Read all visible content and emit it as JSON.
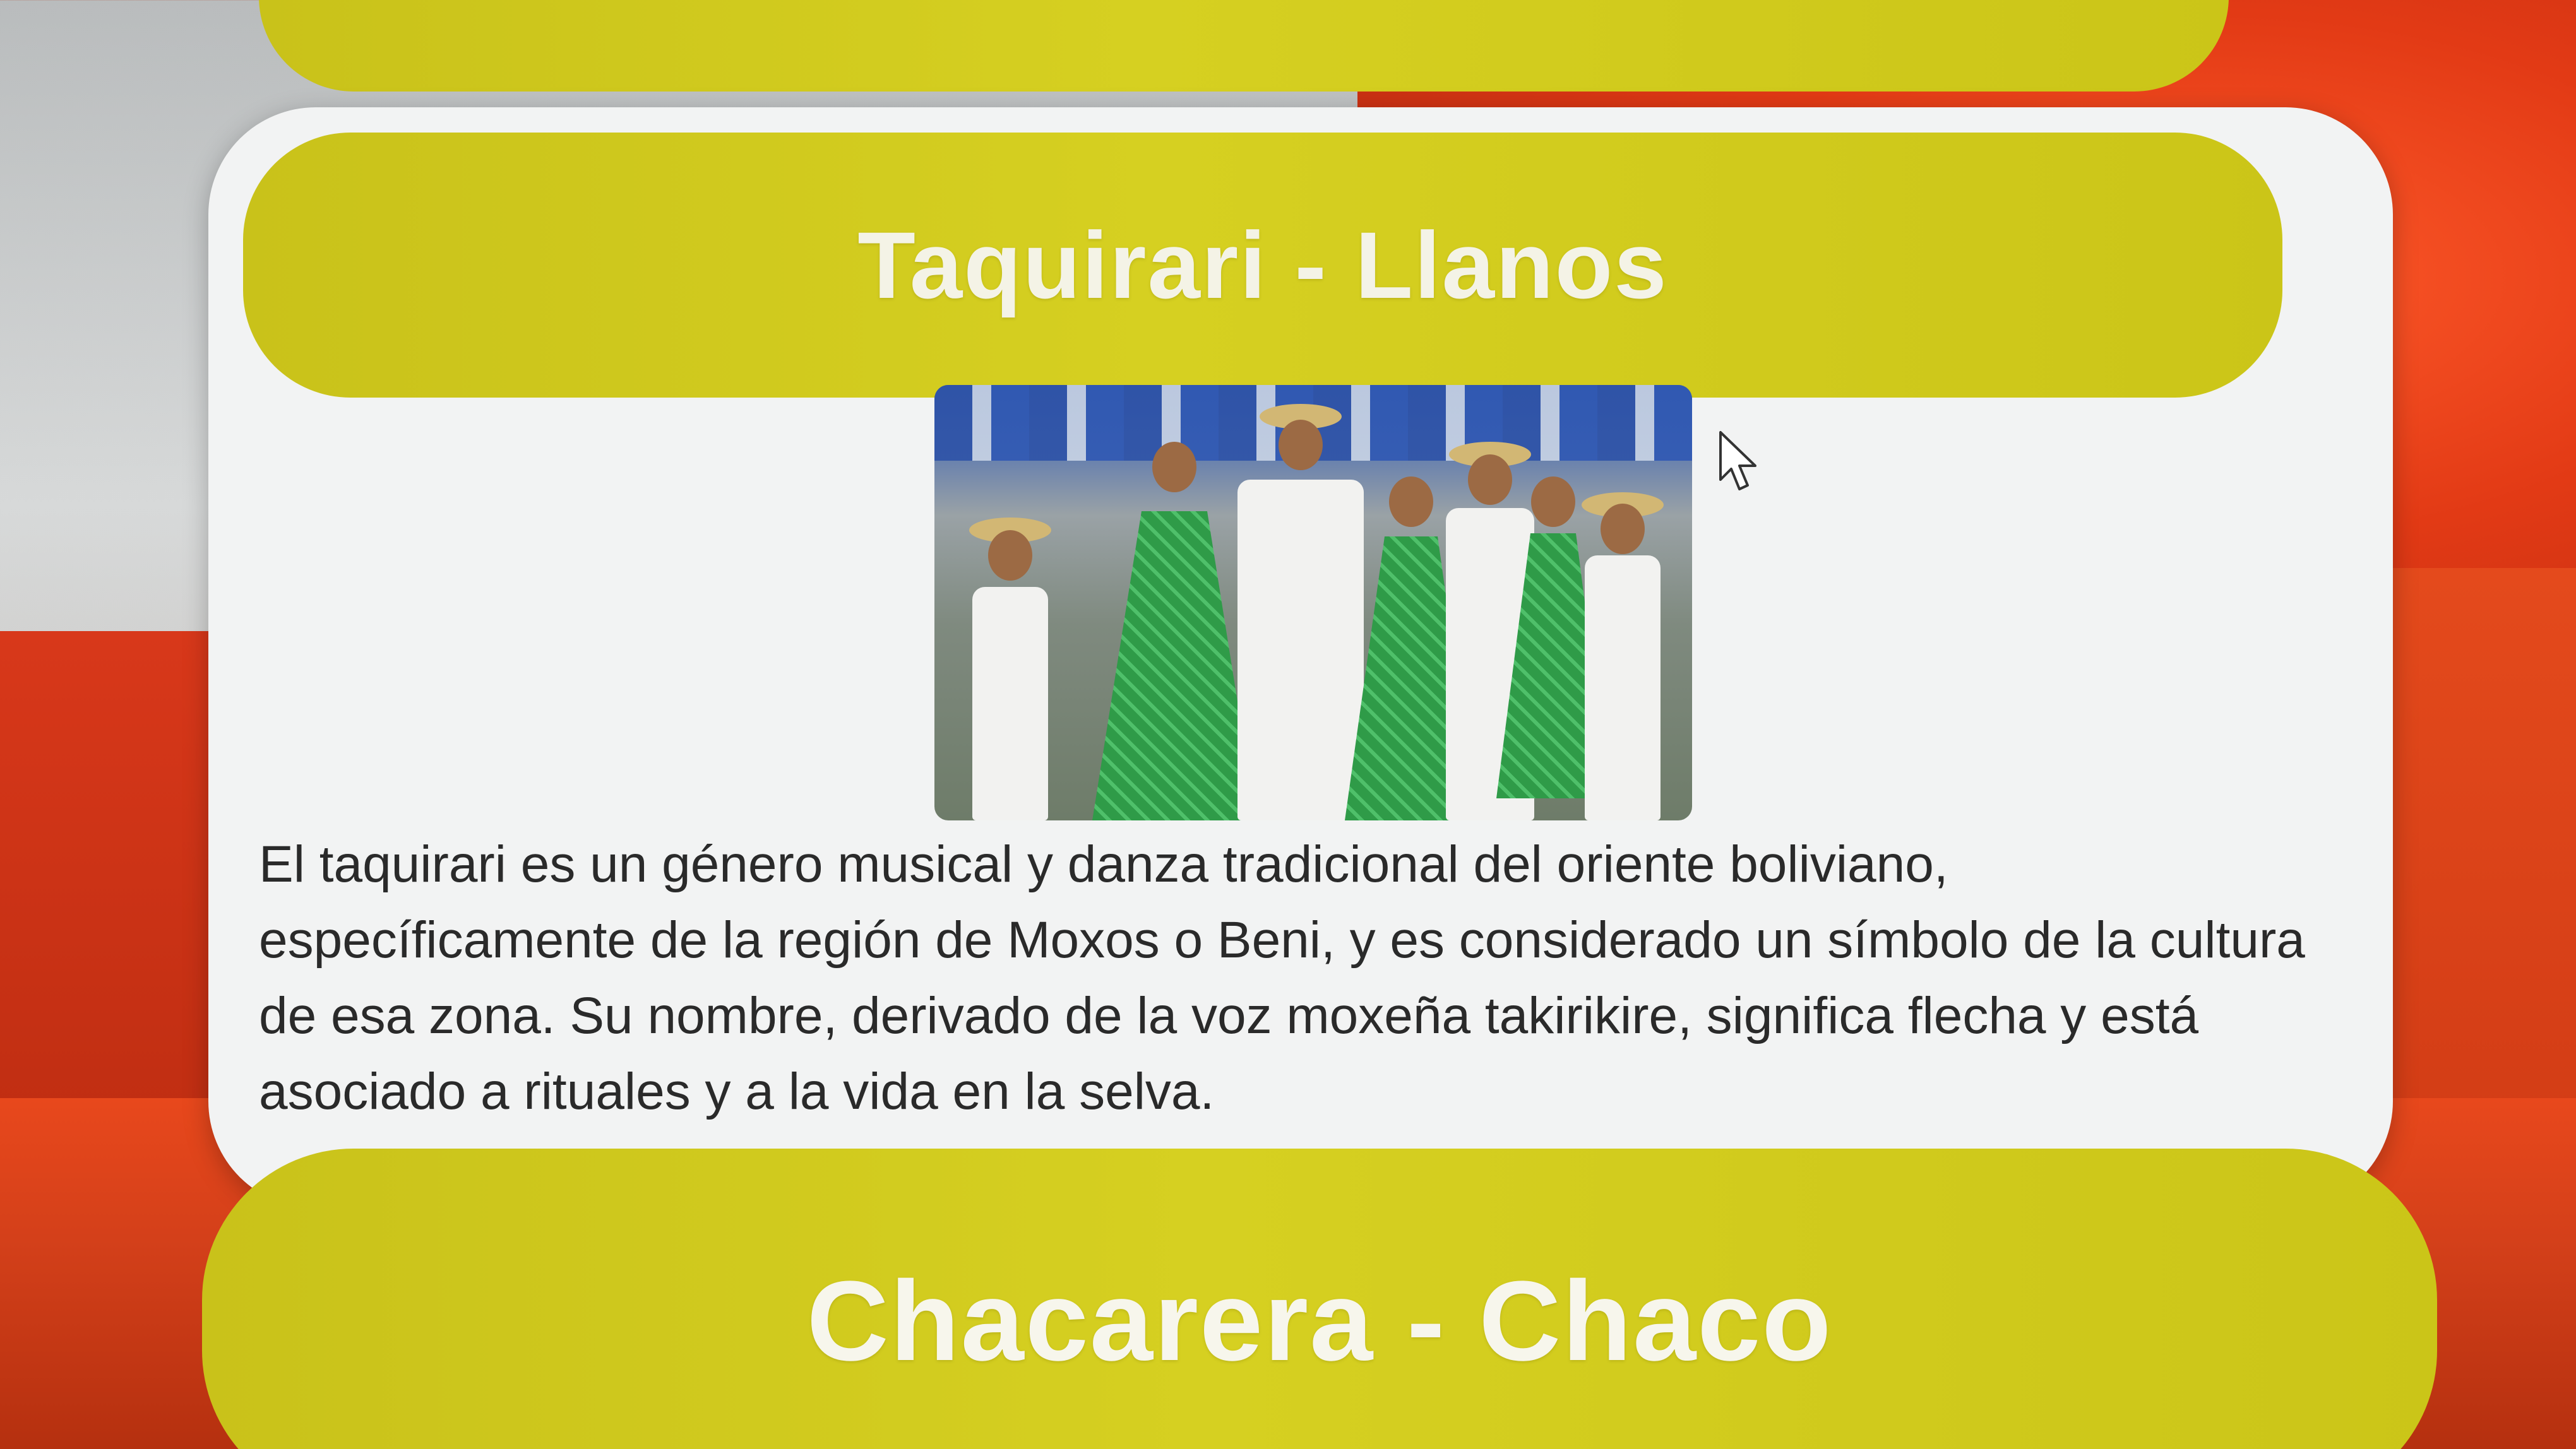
{
  "sections": {
    "previous": {
      "title": ""
    },
    "current": {
      "title": "Taquirari - Llanos",
      "image_alt": "Bailarines de taquirari con vestidos verdes y camisas blancas",
      "description": "El taquirari es un género musical y danza tradicional del oriente boliviano, específicamente de la región de Moxos o Beni, y es considerado un símbolo de la cultura de esa zona. Su nombre, derivado de la voz moxeña takirikire, significa flecha y está asociado a rituales y a la vida en la selva."
    },
    "next": {
      "title": "Chacarera - Chaco"
    }
  },
  "colors": {
    "pill": "#d6d021",
    "card": "#f2f3f3",
    "background_red": "#e23a15"
  },
  "icons": {
    "cursor": "arrow-cursor-icon"
  }
}
